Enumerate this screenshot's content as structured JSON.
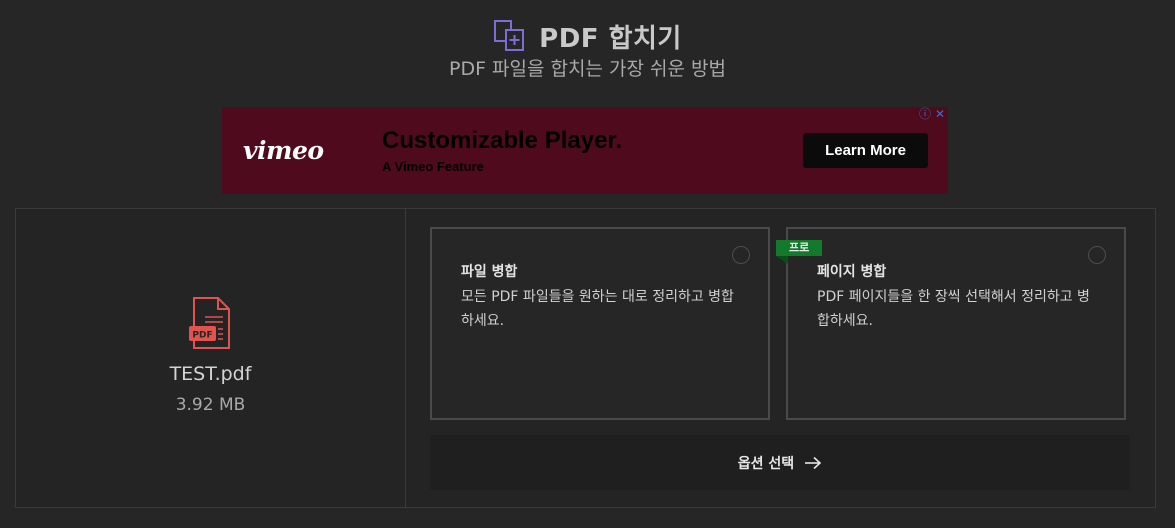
{
  "header": {
    "title": "PDF 합치기",
    "subtitle": "PDF 파일을 합치는 가장 쉬운 방법",
    "icon": "merge-files-icon",
    "accent_color": "#7b6fd6"
  },
  "ad": {
    "logo": "vimeo",
    "headline": "Customizable Player.",
    "subheadline": "A Vimeo Feature",
    "cta_label": "Learn More",
    "info_icon": "ⓘ",
    "close_icon": "✕",
    "background_color": "#4f0a1e"
  },
  "file": {
    "icon": "pdf-file-icon",
    "icon_label": "PDF",
    "name": "TEST.pdf",
    "size": "3.92 MB",
    "icon_color": "#e0534e"
  },
  "options": [
    {
      "title": "파일 병합",
      "description": "모든 PDF 파일들을 원하는 대로 정리하고 병합하세요.",
      "selected": false
    },
    {
      "title": "페이지 병합",
      "description": "PDF 페이지들을 한 장씩 선택해서 정리하고 병합하세요.",
      "badge": "프로",
      "badge_color": "#137a2c",
      "selected": false
    }
  ],
  "action": {
    "label": "옵션 선택",
    "icon": "arrow-right-icon"
  }
}
